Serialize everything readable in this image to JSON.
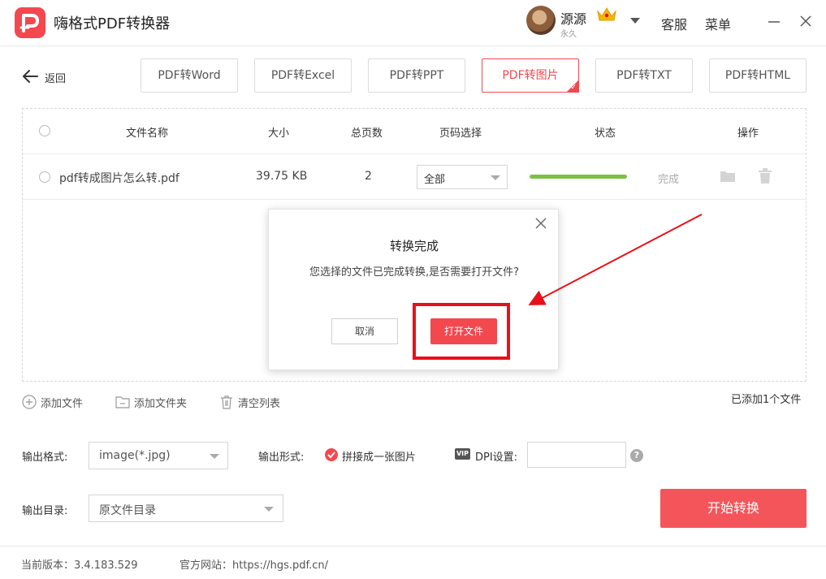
{
  "app": {
    "title": "嗨格式PDF转换器",
    "logo_icon": "pdf-logo-icon",
    "accent": "#f4484f"
  },
  "user": {
    "name": "源源",
    "membership": "永久"
  },
  "header": {
    "service_label": "客服",
    "menu_label": "菜单"
  },
  "nav": {
    "back_label": "返回"
  },
  "tabs": [
    {
      "label": "PDF转Word",
      "active": false
    },
    {
      "label": "PDF转Excel",
      "active": false
    },
    {
      "label": "PDF转PPT",
      "active": false
    },
    {
      "label": "PDF转图片",
      "active": true
    },
    {
      "label": "PDF转TXT",
      "active": false
    },
    {
      "label": "PDF转HTML",
      "active": false
    }
  ],
  "table": {
    "headers": {
      "name": "文件名称",
      "size": "大小",
      "pages": "总页数",
      "page_select": "页码选择",
      "status": "状态",
      "actions": "操作"
    },
    "rows": [
      {
        "name": "pdf转成图片怎么转.pdf",
        "size": "39.75 KB",
        "pages": "2",
        "page_select": "全部",
        "progress": 1.0,
        "status": "完成"
      }
    ]
  },
  "table_actions": {
    "add_file": "添加文件",
    "add_folder": "添加文件夹",
    "clear_list": "清空列表",
    "count_text": "已添加1个文件"
  },
  "settings": {
    "format_label": "输出格式:",
    "format_value": "image(*.jpg)",
    "mode_label": "输出形式:",
    "mode_option": "拼接成一张图片",
    "dpi_badge": "VIP",
    "dpi_label": "DPI设置:",
    "dpi_value": "",
    "help_symbol": "?",
    "dir_label": "输出目录:",
    "dir_value": "原文件目录",
    "start_label": "开始转换"
  },
  "footer": {
    "version": "当前版本：3.4.183.529",
    "website": "官方网站：https://hgs.pdf.cn/"
  },
  "modal": {
    "title": "转换完成",
    "message": "您选择的文件已完成转换,是否需要打开文件?",
    "cancel_label": "取消",
    "open_label": "打开文件"
  },
  "annotation": {
    "color": "#e8101a"
  }
}
